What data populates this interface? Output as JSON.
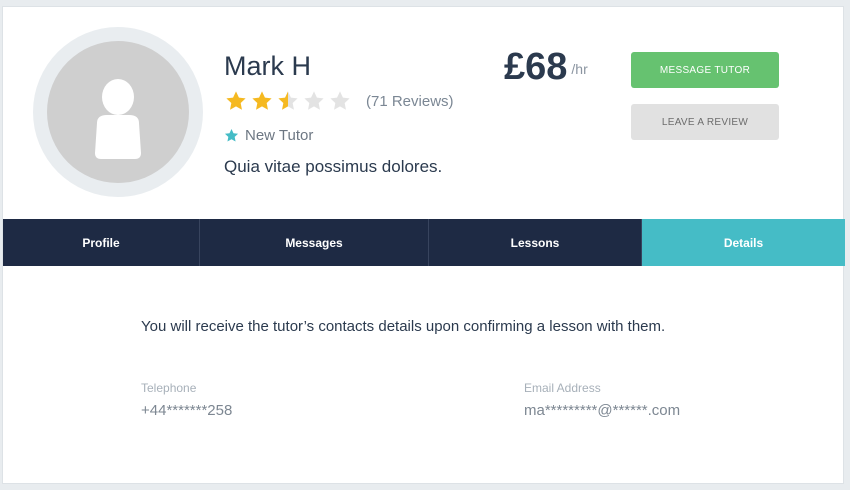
{
  "profile": {
    "name": "Mark H",
    "rating": 2.5,
    "rating_max": 5,
    "reviews_text": "(71 Reviews)",
    "badge_text": "New Tutor",
    "tagline": "Quia vitae possimus dolores.",
    "price": "£68",
    "price_unit": "/hr"
  },
  "actions": {
    "message_label": "MESSAGE TUTOR",
    "review_label": "LEAVE A REVIEW"
  },
  "tabs": [
    {
      "label": "Profile",
      "active": false
    },
    {
      "label": "Messages",
      "active": false
    },
    {
      "label": "Lessons",
      "active": false
    },
    {
      "label": "Details",
      "active": true
    }
  ],
  "details": {
    "notice": "You will receive the tutor’s contacts details upon confirming a lesson with them.",
    "telephone_label": "Telephone",
    "telephone_value": "+44*******258",
    "email_label": "Email Address",
    "email_value": "ma*********@******.com"
  },
  "colors": {
    "star_filled": "#f5b921",
    "star_empty": "#e3e3e3",
    "badge_star": "#45bcc6",
    "accent_green": "#66c270",
    "tab_bg": "#1e2a44",
    "tab_active": "#45bcc6"
  },
  "icons": {
    "avatar": "user-placeholder-icon",
    "star": "star-icon",
    "badge": "star-badge-icon"
  }
}
